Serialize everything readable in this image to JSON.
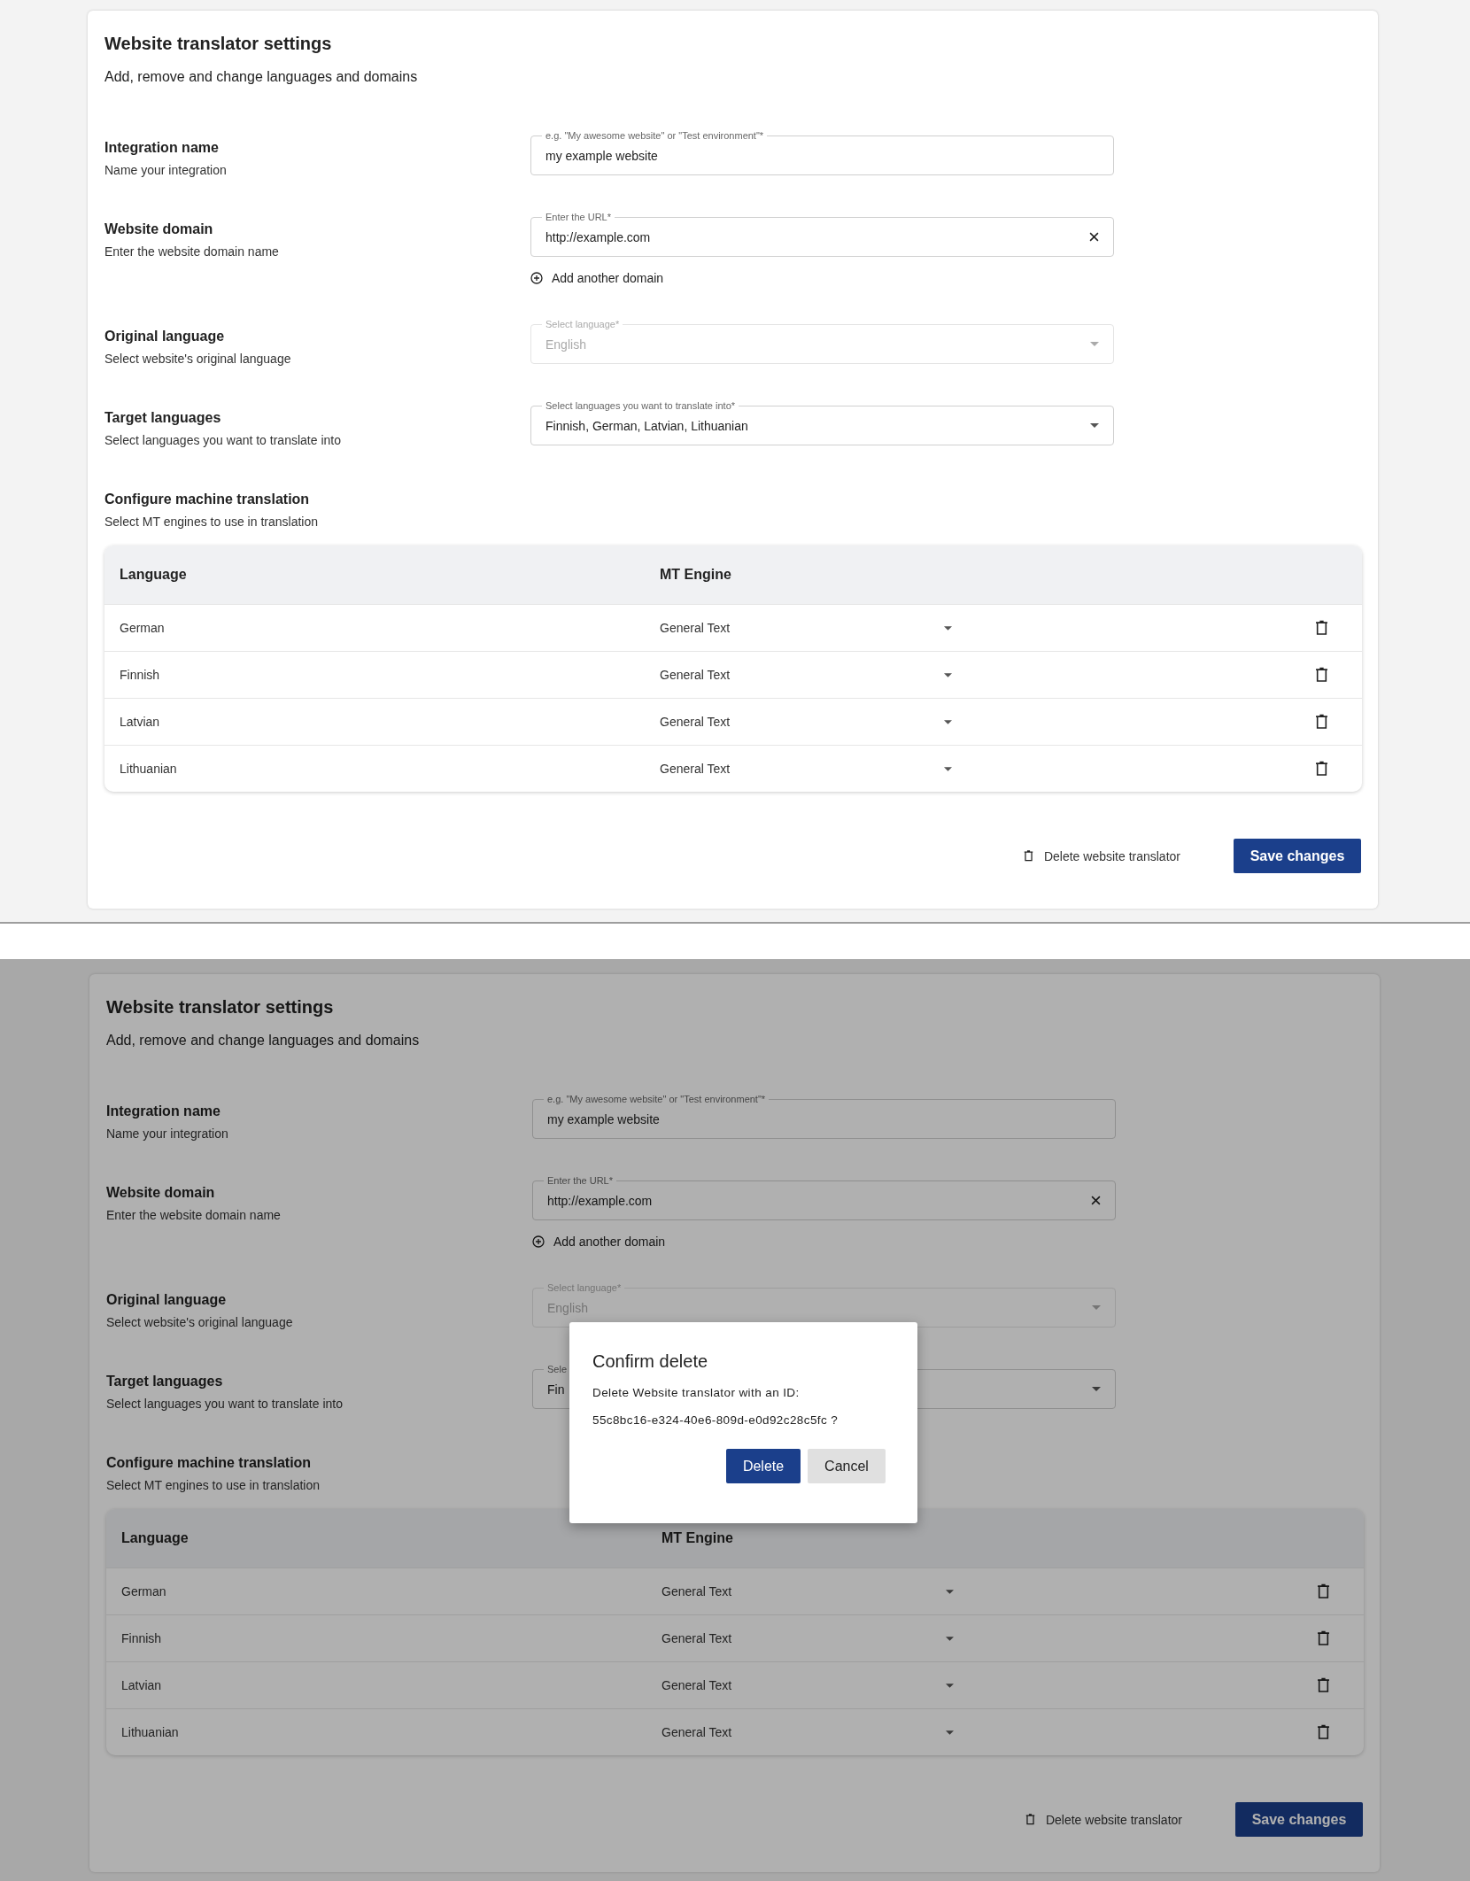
{
  "screens": [
    {
      "dimmed": false,
      "card": {
        "title": "Website translator settings",
        "subtitle": "Add, remove and change languages and domains",
        "rows": [
          {
            "label": "Integration name",
            "description": "Name your integration",
            "field": {
              "kind": "text",
              "floating_label": "e.g. \"My awesome website\" or \"Test environment\"*",
              "value": "my example website",
              "disabled": false
            }
          },
          {
            "label": "Website domain",
            "description": "Enter the website domain name",
            "field": {
              "kind": "clearable",
              "floating_label": "Enter the URL*",
              "value": "http://example.com",
              "disabled": false
            },
            "link": "Add another domain"
          },
          {
            "label": "Original language",
            "description": "Select website's original language",
            "field": {
              "kind": "select",
              "floating_label": "Select language*",
              "value": "English",
              "disabled": true
            }
          },
          {
            "label": "Target languages",
            "description": "Select languages you want to translate into",
            "field": {
              "kind": "select",
              "floating_label": "Select languages you want to translate into*",
              "value": "Finnish, German, Latvian, Lithuanian",
              "disabled": false
            }
          },
          {
            "label": "Configure machine translation",
            "description": "Select MT engines to use in translation"
          }
        ],
        "table": {
          "columns": [
            "Language",
            "MT Engine"
          ],
          "rows": [
            {
              "language": "German",
              "engine": "General Text"
            },
            {
              "language": "Finnish",
              "engine": "General Text"
            },
            {
              "language": "Latvian",
              "engine": "General Text"
            },
            {
              "language": "Lithuanian",
              "engine": "General Text"
            }
          ]
        },
        "delete_link": "Delete website translator",
        "save_button": "Save changes"
      }
    },
    {
      "dimmed": true,
      "card": {
        "title": "Website translator settings",
        "subtitle": "Add, remove and change languages and domains",
        "rows": [
          {
            "label": "Integration name",
            "description": "Name your integration",
            "field": {
              "kind": "text",
              "floating_label": "e.g. \"My awesome website\" or \"Test environment\"*",
              "value": "my example website",
              "disabled": false
            }
          },
          {
            "label": "Website domain",
            "description": "Enter the website domain name",
            "field": {
              "kind": "clearable",
              "floating_label": "Enter the URL*",
              "value": "http://example.com",
              "disabled": false
            },
            "link": "Add another domain"
          },
          {
            "label": "Original language",
            "description": "Select website's original language",
            "field": {
              "kind": "select",
              "floating_label": "Select language*",
              "value": "English",
              "disabled": true
            }
          },
          {
            "label": "Target languages",
            "description": "Select languages you want to translate into",
            "field": {
              "kind": "select",
              "floating_label": "Sele",
              "value": "Fin",
              "disabled": false
            }
          },
          {
            "label": "Configure machine translation",
            "description": "Select MT engines to use in translation"
          }
        ],
        "table": {
          "columns": [
            "Language",
            "MT Engine"
          ],
          "rows": [
            {
              "language": "German",
              "engine": "General Text"
            },
            {
              "language": "Finnish",
              "engine": "General Text"
            },
            {
              "language": "Latvian",
              "engine": "General Text"
            },
            {
              "language": "Lithuanian",
              "engine": "General Text"
            }
          ]
        },
        "delete_link": "Delete website translator",
        "save_button": "Save changes"
      },
      "dialog": {
        "title": "Confirm delete",
        "message": "Delete Website translator with an ID:",
        "id_line": "55c8bc16-e324-40e6-809d-e0d92c28c5fc ?",
        "buttons": [
          {
            "label": "Delete",
            "kind": "primary"
          },
          {
            "label": "Cancel",
            "kind": "secondary"
          }
        ]
      }
    }
  ]
}
